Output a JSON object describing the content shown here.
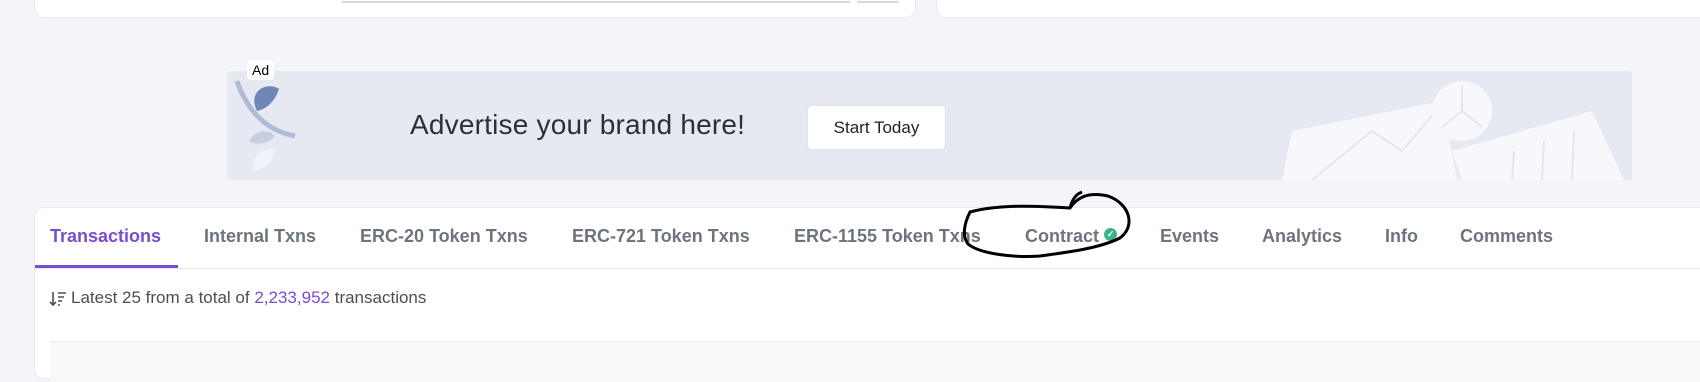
{
  "ad": {
    "tag": "Ad",
    "headline": "Advertise your brand here!",
    "cta": "Start Today"
  },
  "tabs": [
    {
      "label": "Transactions",
      "active": true
    },
    {
      "label": "Internal Txns"
    },
    {
      "label": "ERC-20 Token Txns"
    },
    {
      "label": "ERC-721 Token Txns"
    },
    {
      "label": "ERC-1155 Token Txns"
    },
    {
      "label": "Contract",
      "verified": true
    },
    {
      "label": "Events"
    },
    {
      "label": "Analytics"
    },
    {
      "label": "Info"
    },
    {
      "label": "Comments"
    }
  ],
  "summary": {
    "prefix": "Latest 25 from a total of",
    "count": "2,233,952",
    "suffix": "transactions"
  },
  "colors": {
    "accent": "#7b4ccf",
    "verified": "#3cb38f"
  }
}
